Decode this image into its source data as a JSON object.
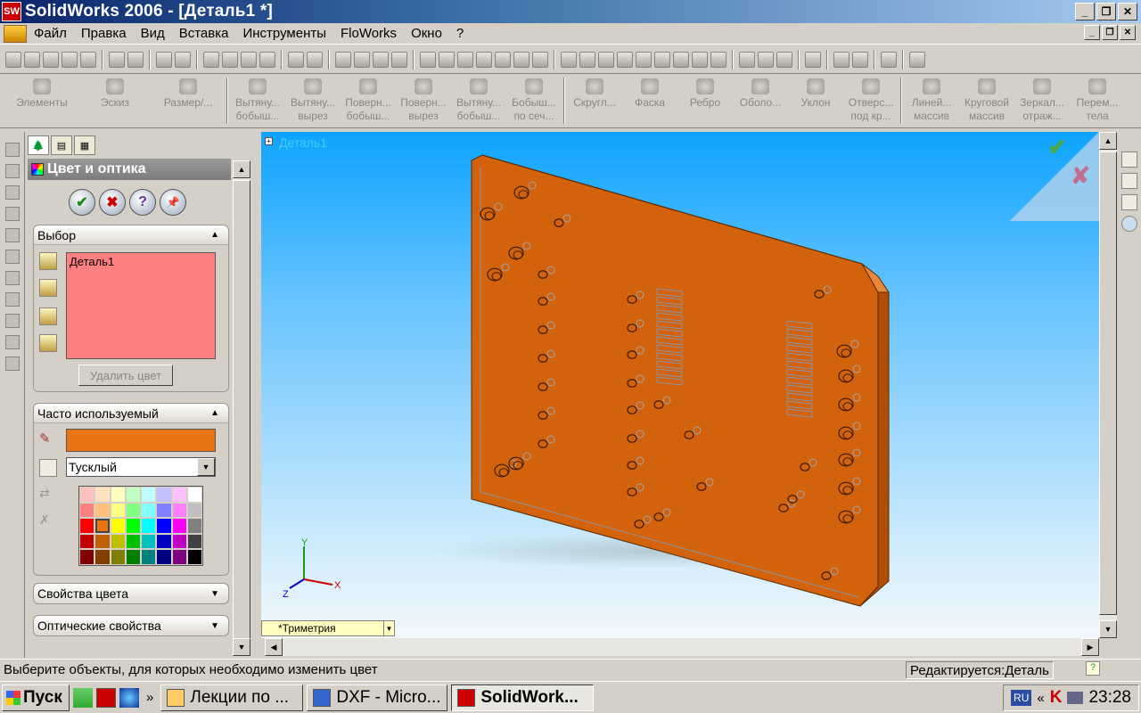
{
  "window": {
    "title": "SolidWorks 2006 - [Деталь1 *]",
    "app_icon": "solidworks-icon",
    "controls": [
      "_",
      "❐",
      "✕"
    ]
  },
  "menu": {
    "items": [
      "Файл",
      "Правка",
      "Вид",
      "Вставка",
      "Инструменты",
      "FloWorks",
      "Окно",
      "?"
    ]
  },
  "command_manager": {
    "groups": [
      {
        "label": "Элементы"
      },
      {
        "label": "Эскиз"
      },
      {
        "label": "Размер/..."
      }
    ],
    "commands": [
      {
        "line1": "Вытяну...",
        "line2": "бобыш..."
      },
      {
        "line1": "Вытяну...",
        "line2": "вырез"
      },
      {
        "line1": "Поверн...",
        "line2": "бобыш..."
      },
      {
        "line1": "Поверн...",
        "line2": "вырез"
      },
      {
        "line1": "Вытяну...",
        "line2": "бобыш..."
      },
      {
        "line1": "Бобыш...",
        "line2": "по сеч..."
      },
      {
        "line1": "Скругл...",
        "line2": ""
      },
      {
        "line1": "Фаска",
        "line2": ""
      },
      {
        "line1": "Ребро",
        "line2": ""
      },
      {
        "line1": "Оболо...",
        "line2": ""
      },
      {
        "line1": "Уклон",
        "line2": ""
      },
      {
        "line1": "Отверс...",
        "line2": "под кр..."
      },
      {
        "line1": "Линей...",
        "line2": "массив"
      },
      {
        "line1": "Круговой",
        "line2": "массив"
      },
      {
        "line1": "Зеркал...",
        "line2": "отраж..."
      },
      {
        "line1": "Перем...",
        "line2": "тела"
      }
    ]
  },
  "property_manager": {
    "title": "Цвет и оптика",
    "buttons": {
      "ok": "✔",
      "cancel": "✖",
      "help": "?",
      "pin": "📌"
    },
    "selection": {
      "header": "Выбор",
      "item": "Деталь1",
      "remove_button": "Удалить цвет"
    },
    "frequent": {
      "header": "Часто используемый",
      "current_color": "#e87414",
      "finish": "Тусклый",
      "palette": [
        "#ffc0c0",
        "#ffe0c0",
        "#ffffc0",
        "#c0ffc0",
        "#c0ffff",
        "#c0c0ff",
        "#ffc0ff",
        "#ffffff",
        "#ff8080",
        "#ffc080",
        "#ffff80",
        "#80ff80",
        "#80ffff",
        "#8080ff",
        "#ff80ff",
        "#c0c0c0",
        "#ff0000",
        "#e87414",
        "#ffff00",
        "#00ff00",
        "#00ffff",
        "#0000ff",
        "#ff00ff",
        "#808080",
        "#c00000",
        "#c06000",
        "#c0c000",
        "#00c000",
        "#00c0c0",
        "#0000c0",
        "#c000c0",
        "#404040",
        "#800000",
        "#804000",
        "#808000",
        "#008000",
        "#008080",
        "#000080",
        "#800080",
        "#000000"
      ]
    },
    "color_properties": "Свойства цвета",
    "optical_properties": "Оптические свойства"
  },
  "viewport": {
    "tree_item": "Деталь1",
    "view_name": "*Триметрия",
    "part_color": "#d2620c",
    "axes": {
      "x": "X",
      "y": "Y",
      "z": "Z"
    }
  },
  "status": {
    "message": "Выберите объекты, для которых необходимо изменить цвет",
    "mode": "Редактируется:Деталь"
  },
  "taskbar": {
    "start": "Пуск",
    "tasks": [
      {
        "label": "Лекции по ...",
        "icon": "search-folder-icon"
      },
      {
        "label": "DXF - Micro...",
        "icon": "word-icon"
      },
      {
        "label": "SolidWork...",
        "icon": "solidworks-icon",
        "active": true
      }
    ],
    "lang": "RU",
    "time": "23:28"
  }
}
